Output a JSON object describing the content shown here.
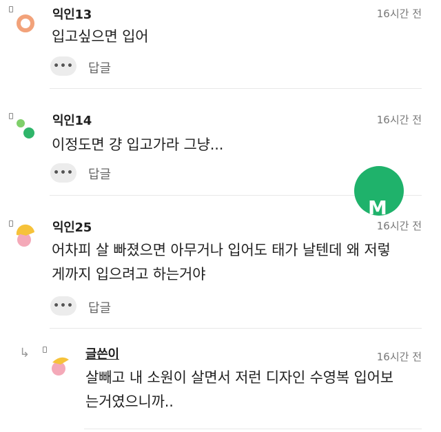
{
  "comments": [
    {
      "name": "익인13",
      "time": "16시간 전",
      "lines": [
        "입고싶으면 입어"
      ],
      "more": "•••",
      "reply": "답글"
    },
    {
      "name": "익인14",
      "time": "16시간 전",
      "lines": [
        "이정도면 걍 입고가라 그냥..."
      ],
      "more": "•••",
      "reply": "답글"
    },
    {
      "name": "익인25",
      "time": "16시간 전",
      "lines": [
        "어차피 살 빠졌으면 아무거나 입어도 태가 날텐데 왜 저렇",
        "게까지 입으려고 하는거야"
      ],
      "more": "•••",
      "reply": "답글"
    },
    {
      "name": "글쓴이",
      "time": "16시간 전",
      "lines": [
        "살빼고 내 소원이 살면서 저런 디자인 수영복 입어보",
        "는거였으니까.."
      ]
    }
  ],
  "icons": {
    "reply_arrow": "reply-arrow-icon",
    "pin": "pin-icon",
    "more": "more-dots-icon"
  },
  "colors": {
    "fab": "#1fb26b",
    "avatar_orange": "#f2a27a",
    "avatar_green_light": "#7fcf6a",
    "avatar_green_dark": "#2fb56a",
    "avatar_yellow": "#f6c23a",
    "avatar_pink": "#f4a9b8"
  }
}
